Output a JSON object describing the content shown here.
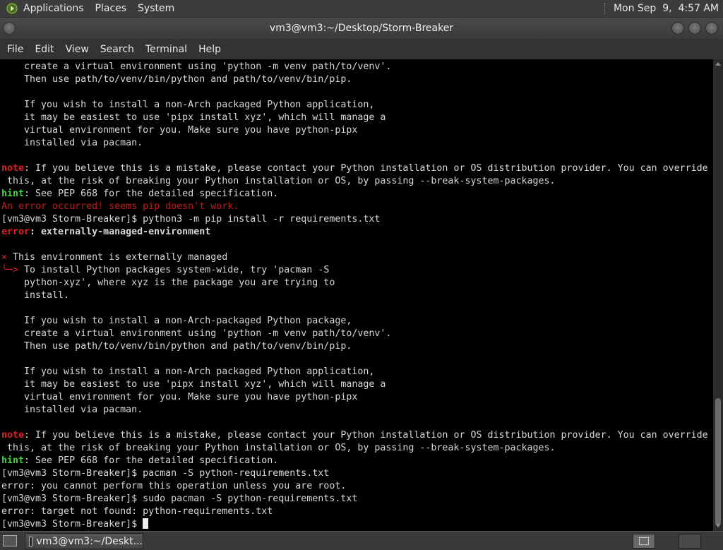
{
  "top_panel": {
    "menus": [
      "Applications",
      "Places",
      "System"
    ],
    "clock": "Mon Sep  9,  4:57 AM"
  },
  "window": {
    "title": "vm3@vm3:~/Desktop/Storm-Breaker"
  },
  "menu_bar": {
    "items": [
      "File",
      "Edit",
      "View",
      "Search",
      "Terminal",
      "Help"
    ]
  },
  "terminal": {
    "lines": [
      [
        [
          "",
          "    create a virtual environment using 'python -m venv path/to/venv'."
        ]
      ],
      [
        [
          "",
          "    Then use path/to/venv/bin/python and path/to/venv/bin/pip."
        ]
      ],
      [
        [
          "",
          ""
        ]
      ],
      [
        [
          "",
          "    If you wish to install a non-Arch packaged Python application,"
        ]
      ],
      [
        [
          "",
          "    it may be easiest to use 'pipx install xyz', which will manage a"
        ]
      ],
      [
        [
          "",
          "    virtual environment for you. Make sure you have python-pipx"
        ]
      ],
      [
        [
          "",
          "    installed via pacman."
        ]
      ],
      [
        [
          "",
          ""
        ]
      ],
      [
        [
          "note",
          "note"
        ],
        [
          "",
          ": If you believe this is a mistake, please contact your Python installation or OS distribution provider. You can override"
        ]
      ],
      [
        [
          "",
          " this, at the risk of breaking your Python installation or OS, by passing --break-system-packages."
        ]
      ],
      [
        [
          "hint",
          "hint"
        ],
        [
          "",
          ": See PEP 668 for the detailed specification."
        ]
      ],
      [
        [
          "dim",
          "An error occurred! seems pip doesn't work."
        ]
      ],
      [
        [
          "",
          "[vm3@vm3 Storm-Breaker]$ python3 -m pip install -r requirements.txt"
        ]
      ],
      [
        [
          "err",
          "error"
        ],
        [
          "bold",
          ": externally-managed-environment"
        ]
      ],
      [
        [
          "",
          ""
        ]
      ],
      [
        [
          "red",
          "×"
        ],
        [
          "",
          " This environment is externally managed"
        ]
      ],
      [
        [
          "red",
          "╰─>"
        ],
        [
          "",
          " To install Python packages system-wide, try 'pacman -S"
        ]
      ],
      [
        [
          "",
          "    python-xyz', where xyz is the package you are trying to"
        ]
      ],
      [
        [
          "",
          "    install."
        ]
      ],
      [
        [
          "",
          ""
        ]
      ],
      [
        [
          "",
          "    If you wish to install a non-Arch-packaged Python package,"
        ]
      ],
      [
        [
          "",
          "    create a virtual environment using 'python -m venv path/to/venv'."
        ]
      ],
      [
        [
          "",
          "    Then use path/to/venv/bin/python and path/to/venv/bin/pip."
        ]
      ],
      [
        [
          "",
          ""
        ]
      ],
      [
        [
          "",
          "    If you wish to install a non-Arch packaged Python application,"
        ]
      ],
      [
        [
          "",
          "    it may be easiest to use 'pipx install xyz', which will manage a"
        ]
      ],
      [
        [
          "",
          "    virtual environment for you. Make sure you have python-pipx"
        ]
      ],
      [
        [
          "",
          "    installed via pacman."
        ]
      ],
      [
        [
          "",
          ""
        ]
      ],
      [
        [
          "note",
          "note"
        ],
        [
          "",
          ": If you believe this is a mistake, please contact your Python installation or OS distribution provider. You can override"
        ]
      ],
      [
        [
          "",
          " this, at the risk of breaking your Python installation or OS, by passing --break-system-packages."
        ]
      ],
      [
        [
          "hint",
          "hint"
        ],
        [
          "",
          ": See PEP 668 for the detailed specification."
        ]
      ],
      [
        [
          "",
          "[vm3@vm3 Storm-Breaker]$ pacman -S python-requirements.txt"
        ]
      ],
      [
        [
          "",
          "error: you cannot perform this operation unless you are root."
        ]
      ],
      [
        [
          "",
          "[vm3@vm3 Storm-Breaker]$ sudo pacman -S python-requirements.txt"
        ]
      ],
      [
        [
          "",
          "error: target not found: python-requirements.txt"
        ]
      ],
      [
        [
          "",
          "[vm3@vm3 Storm-Breaker]$ "
        ],
        [
          "cursor",
          ""
        ]
      ]
    ]
  },
  "taskbar": {
    "task_label": "vm3@vm3:~/Deskt..."
  },
  "colors": {
    "error_red": "#e02020",
    "hint_green": "#3ed23e",
    "terminal_bg": "#000000",
    "terminal_fg": "#d8d8d8"
  },
  "icons": {
    "apps": "applications-menu-icon",
    "desktop": "show-desktop-icon",
    "terminal": "terminal-icon"
  }
}
